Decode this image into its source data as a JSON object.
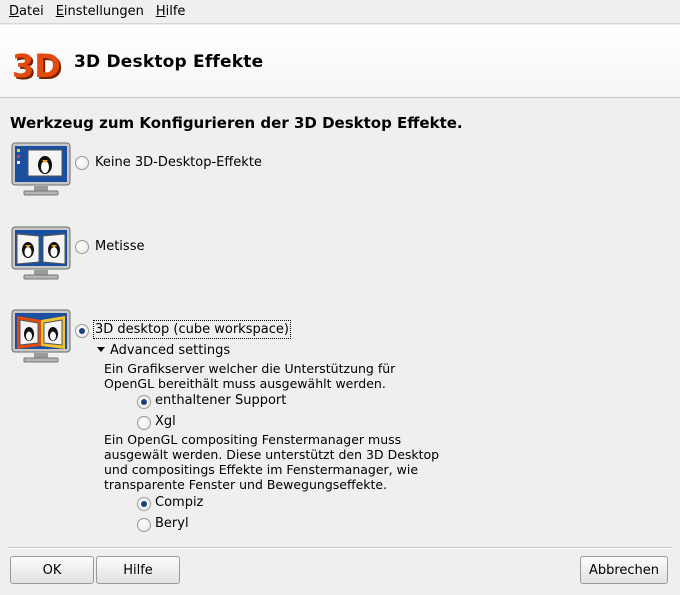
{
  "menubar": {
    "items": [
      {
        "accel": "D",
        "rest": "atei"
      },
      {
        "accel": "E",
        "rest": "instellungen"
      },
      {
        "accel": "H",
        "rest": "ilfe"
      }
    ]
  },
  "banner": {
    "logo_text": "3D",
    "title": "3D Desktop Effekte"
  },
  "heading": "Werkzeug zum Konfigurieren der 3D Desktop Effekte.",
  "options": [
    {
      "label": "Keine 3D-Desktop-Effekte",
      "checked": false
    },
    {
      "label": "Metisse",
      "checked": false
    },
    {
      "label": "3D desktop (cube workspace)",
      "checked": true
    }
  ],
  "advanced": {
    "toggle_label": "Advanced settings",
    "server_text": [
      "Ein Grafikserver welcher die Unterstützung für",
      "OpenGL bereithält muss ausgewählt werden."
    ],
    "server_options": [
      {
        "label": "enthaltener Support",
        "checked": true
      },
      {
        "label": "Xgl",
        "checked": false
      }
    ],
    "wm_text": [
      "Ein OpenGL compositing Fenstermanager muss",
      "ausgewält werden. Diese unterstützt den 3D Desktop",
      "und compositings Effekte im Fenstermanager, wie",
      "transparente Fenster und Bewegungseffekte."
    ],
    "wm_options": [
      {
        "label": "Compiz",
        "checked": true
      },
      {
        "label": "Beryl",
        "checked": false
      }
    ]
  },
  "buttons": {
    "ok": "OK",
    "help": "Hilfe",
    "cancel": "Abbrechen"
  },
  "colors": {
    "window_bg": "#efefef",
    "logo_red": "#e24a0e",
    "screen_blue": "#1b4fa0",
    "radio_dot": "#1f3f7a"
  }
}
